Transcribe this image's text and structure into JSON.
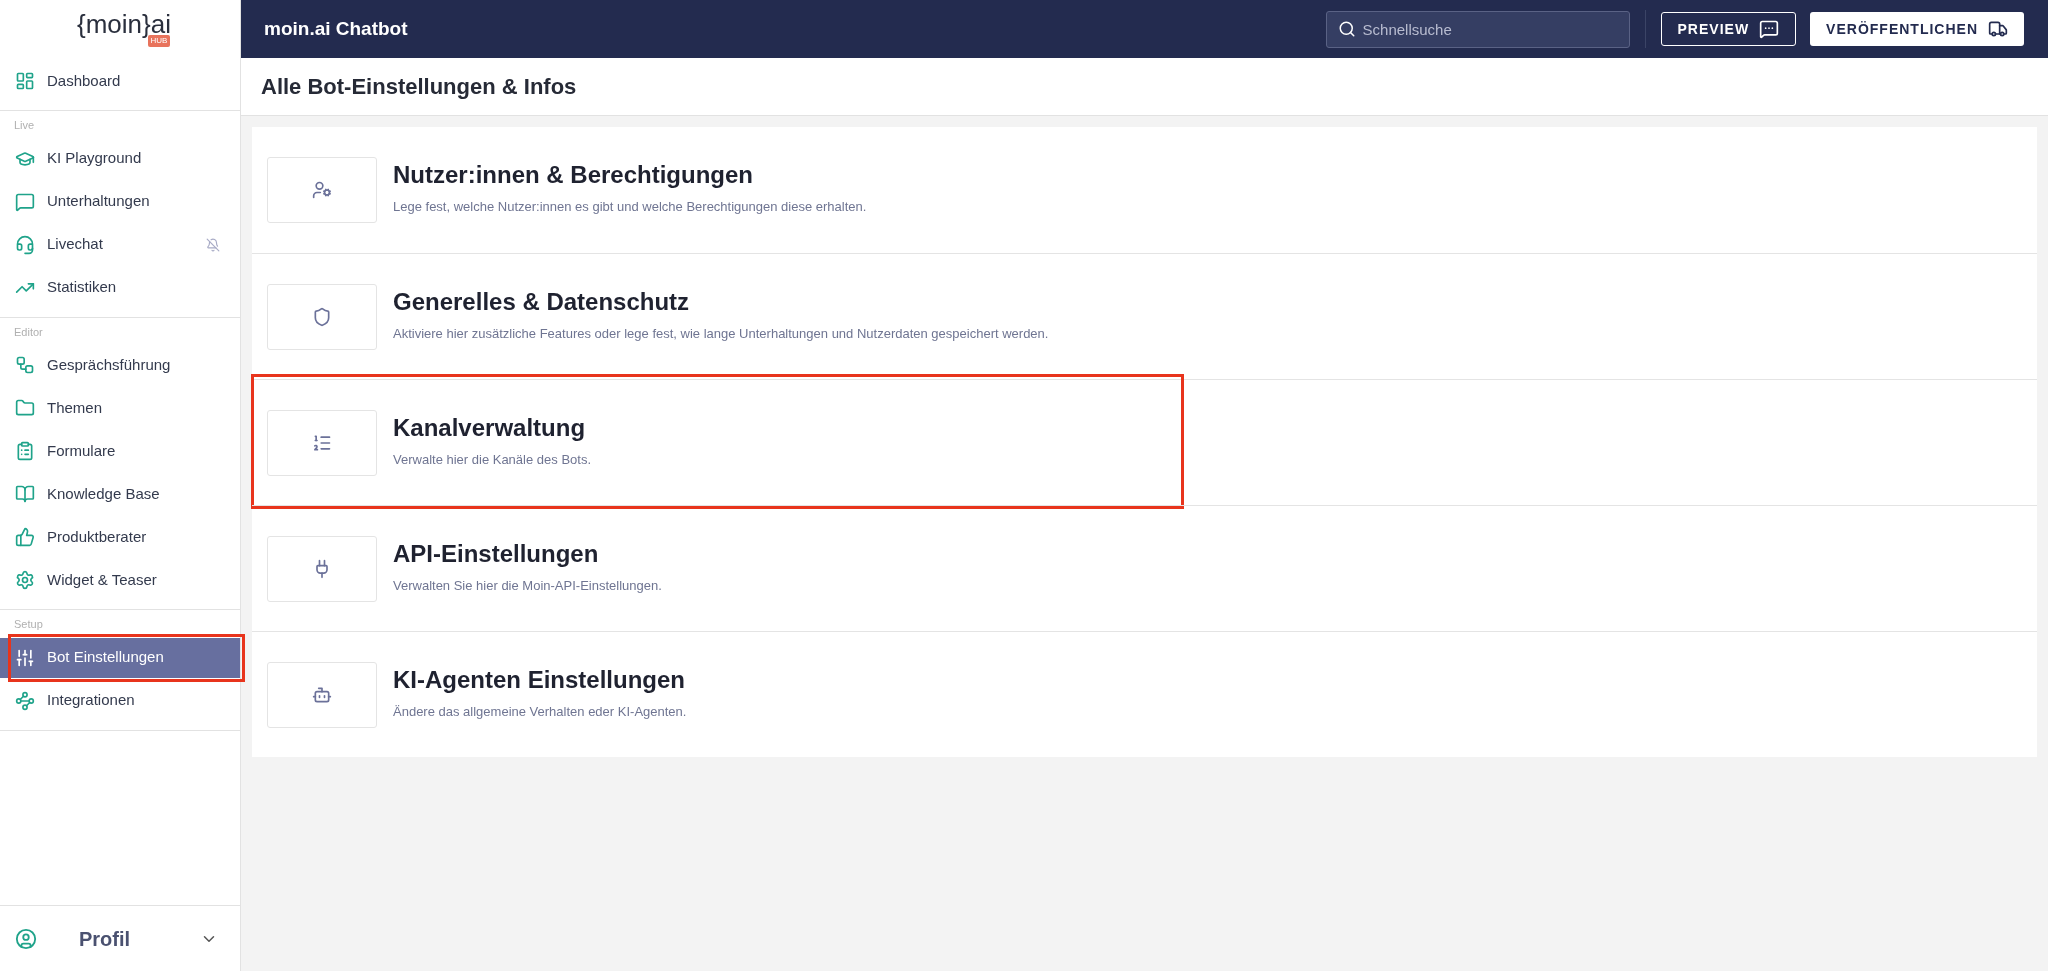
{
  "logo": {
    "text": "{moin}ai",
    "badge": "HUB"
  },
  "sidebar": {
    "sections": [
      {
        "items": [
          {
            "label": "Dashboard",
            "selected": false,
            "highlighted": false
          }
        ]
      },
      {
        "label": "Live",
        "items": [
          {
            "label": "KI Playground",
            "selected": false,
            "highlighted": false
          },
          {
            "label": "Unterhaltungen",
            "selected": false,
            "highlighted": false
          },
          {
            "label": "Livechat",
            "selected": false,
            "highlighted": false
          },
          {
            "label": "Statistiken",
            "selected": false,
            "highlighted": false
          }
        ]
      },
      {
        "label": "Editor",
        "items": [
          {
            "label": "Gesprächsführung",
            "selected": false,
            "highlighted": false
          },
          {
            "label": "Themen",
            "selected": false,
            "highlighted": false
          },
          {
            "label": "Formulare",
            "selected": false,
            "highlighted": false
          },
          {
            "label": "Knowledge Base",
            "selected": false,
            "highlighted": false
          },
          {
            "label": "Produktberater",
            "selected": false,
            "highlighted": false
          },
          {
            "label": "Widget & Teaser",
            "selected": false,
            "highlighted": false
          }
        ]
      },
      {
        "label": "Setup",
        "items": [
          {
            "label": "Bot Einstellungen",
            "selected": true,
            "highlighted": true
          },
          {
            "label": "Integrationen",
            "selected": false,
            "highlighted": false
          }
        ]
      }
    ],
    "profile": {
      "label": "Profil"
    }
  },
  "header": {
    "title": "moin.ai Chatbot",
    "search": {
      "placeholder": "Schnellsuche"
    },
    "buttons": [
      "PREVIEW",
      "VERÖFFENTLICHEN"
    ]
  },
  "page": {
    "title": "Alle Bot-Einstellungen & Infos",
    "cards": [
      {
        "title": "Nutzer:innen & Berechtigungen",
        "description": "Lege fest, welche Nutzer:innen es gibt und welche Berechtigungen diese erhalten.",
        "highlighted": false
      },
      {
        "title": "Generelles & Datenschutz",
        "description": "Aktiviere hier zusätzliche Features oder lege fest, wie lange Unterhaltungen und Nutzerdaten gespeichert werden.",
        "highlighted": false
      },
      {
        "title": "Kanalverwaltung",
        "description": "Verwalte hier die Kanäle des Bots.",
        "highlighted": true
      },
      {
        "title": "API-Einstellungen",
        "description": "Verwalten Sie hier die Moin-API-Einstellungen.",
        "highlighted": false
      },
      {
        "title": "KI-Agenten Einstellungen",
        "description": "Ändere das allgemeine Verhalten eder KI-Agenten.",
        "highlighted": false
      }
    ]
  }
}
